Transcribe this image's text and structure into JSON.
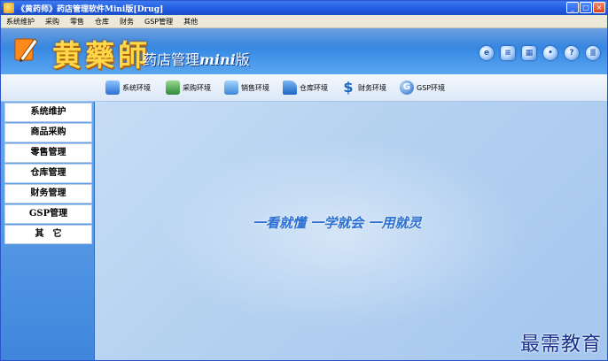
{
  "window": {
    "title": "《黄药师》药店管理软件Mini版[Drug]"
  },
  "window_buttons": {
    "minimize": "_",
    "maximize": "□",
    "close": "×"
  },
  "menubar": [
    {
      "label": "系统维护"
    },
    {
      "label": "采购"
    },
    {
      "label": "零售"
    },
    {
      "label": "仓库"
    },
    {
      "label": "财务"
    },
    {
      "label": "GSP管理"
    },
    {
      "label": "其他"
    }
  ],
  "banner": {
    "logo_text": "黄藥師",
    "subtitle_prefix": "药店管理",
    "subtitle_mini": "mini",
    "subtitle_suffix": "版"
  },
  "toolbar": [
    {
      "label": "系统环境",
      "color": "#2a6fd1"
    },
    {
      "label": "采购环境",
      "color": "#2e8b3a"
    },
    {
      "label": "销售环境",
      "color": "#3a86d8"
    },
    {
      "label": "仓库环境",
      "color": "#1e66c4"
    },
    {
      "label": "财务环境",
      "color": "#1e66c4"
    },
    {
      "label": "GSP环境",
      "color": "#1e66c4"
    }
  ],
  "sidebar": [
    {
      "label": "系统维护"
    },
    {
      "label": "商品采购"
    },
    {
      "label": "零售管理"
    },
    {
      "label": "仓库管理"
    },
    {
      "label": "财务管理"
    },
    {
      "label": "GSP管理"
    },
    {
      "label": "其　它"
    }
  ],
  "main": {
    "slogan": "一看就懂  一学就会  一用就灵",
    "watermark": "最需教育"
  }
}
